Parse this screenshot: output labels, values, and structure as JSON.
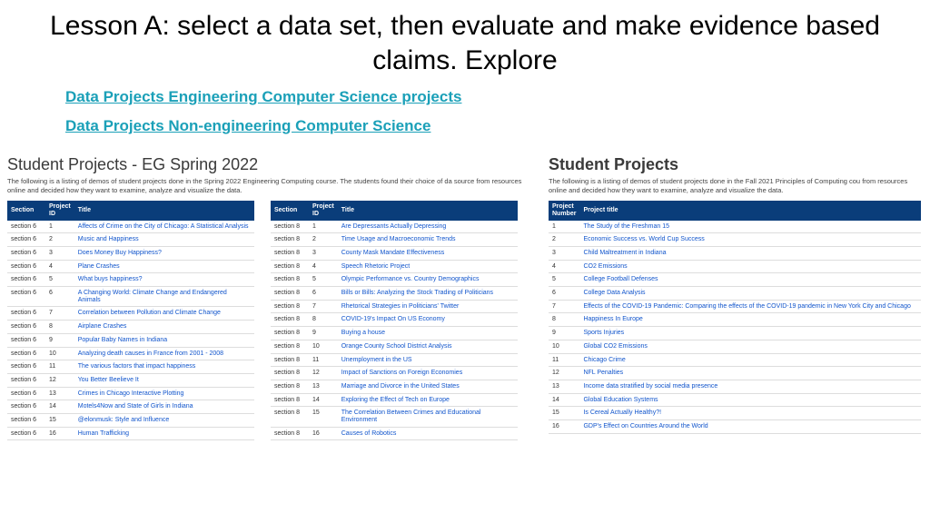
{
  "title": "Lesson A: select a data set, then evaluate and make evidence based claims. Explore",
  "links": {
    "eng": "Data Projects Engineering Computer Science projects",
    "noneng": "Data Projects Non-engineering Computer Science"
  },
  "left": {
    "heading": "Student Projects - EG Spring 2022",
    "desc": "The following is a listing of demos of student projects done in the Spring 2022 Engineering Computing course. The students found their choice of da source from resources online and decided how they want to examine, analyze and visualize the data.",
    "headers": {
      "section": "Section",
      "id": "Project ID",
      "title": "Title"
    },
    "section6": [
      {
        "id": "1",
        "title": "Affects of Crime on the City of Chicago: A Statistical Analysis"
      },
      {
        "id": "2",
        "title": "Music and Happiness"
      },
      {
        "id": "3",
        "title": "Does Money Buy Happiness?"
      },
      {
        "id": "4",
        "title": "Plane Crashes"
      },
      {
        "id": "5",
        "title": "What buys happiness?"
      },
      {
        "id": "6",
        "title": "A Changing World: Climate Change and Endangered Animals"
      },
      {
        "id": "7",
        "title": "Correlation between Pollution and Climate Change"
      },
      {
        "id": "8",
        "title": "Airplane Crashes"
      },
      {
        "id": "9",
        "title": "Popular Baby Names in Indiana"
      },
      {
        "id": "10",
        "title": "Analyzing death causes in France from 2001 - 2008"
      },
      {
        "id": "11",
        "title": "The various factors that impact happiness"
      },
      {
        "id": "12",
        "title": "You Better Beelieve It"
      },
      {
        "id": "13",
        "title": "Crimes in Chicago Interactive Plotting"
      },
      {
        "id": "14",
        "title": "Motels4Now and State of Girls in Indiana"
      },
      {
        "id": "15",
        "title": "@elonmusk: Style and Influence"
      },
      {
        "id": "16",
        "title": "Human Trafficking"
      }
    ],
    "sectionLabel6": "section 6",
    "section8": [
      {
        "id": "1",
        "title": "Are Depressants Actually Depressing"
      },
      {
        "id": "2",
        "title": "Time Usage and Macroeconomic Trends"
      },
      {
        "id": "3",
        "title": "County Mask Mandate Effectiveness"
      },
      {
        "id": "4",
        "title": "Speech Rhetoric Project"
      },
      {
        "id": "5",
        "title": "Olympic Performance vs. Country Demographics"
      },
      {
        "id": "6",
        "title": "Bills or Bills: Analyzing the Stock Trading of Politicians"
      },
      {
        "id": "7",
        "title": "Rhetorical Strategies in Politicians' Twitter"
      },
      {
        "id": "8",
        "title": "COVID-19's Impact On US Economy"
      },
      {
        "id": "9",
        "title": "Buying a house"
      },
      {
        "id": "10",
        "title": "Orange County School District Analysis"
      },
      {
        "id": "11",
        "title": "Unemployment in the US"
      },
      {
        "id": "12",
        "title": "Impact of Sanctions on Foreign Economies"
      },
      {
        "id": "13",
        "title": "Marriage and Divorce in the United States"
      },
      {
        "id": "14",
        "title": "Exploring the Effect of Tech on Europe"
      },
      {
        "id": "15",
        "title": "The Correlation Between Crimes and Educational Environment"
      },
      {
        "id": "16",
        "title": "Causes of Robotics"
      }
    ],
    "sectionLabel8": "section 8"
  },
  "right": {
    "heading": "Student Projects",
    "desc": "The following is a listing of demos of student projects done in the Fall 2021 Principles of Computing cou from resources online and decided how they want to examine, analyze and visualize the data.",
    "headers": {
      "num": "Project Number",
      "title": "Project title"
    },
    "rows": [
      {
        "n": "1",
        "title": "The Study of the Freshman 15"
      },
      {
        "n": "2",
        "title": "Economic Success vs. World Cup Success"
      },
      {
        "n": "3",
        "title": "Child Maltreatment in Indiana"
      },
      {
        "n": "4",
        "title": "CO2 Emissions"
      },
      {
        "n": "5",
        "title": "College Football Defenses"
      },
      {
        "n": "6",
        "title": "College Data Analysis"
      },
      {
        "n": "7",
        "title": "Effects of the COVID-19 Pandemic: Comparing the effects of the COVID-19 pandemic in New York City and Chicago"
      },
      {
        "n": "8",
        "title": "Happiness In Europe"
      },
      {
        "n": "9",
        "title": "Sports Injuries"
      },
      {
        "n": "10",
        "title": "Global CO2 Emissions"
      },
      {
        "n": "11",
        "title": "Chicago Crime"
      },
      {
        "n": "12",
        "title": "NFL Penalties"
      },
      {
        "n": "13",
        "title": "Income data stratified by social media presence"
      },
      {
        "n": "14",
        "title": "Global Education Systems"
      },
      {
        "n": "15",
        "title": "Is Cereal Actually Healthy?!"
      },
      {
        "n": "16",
        "title": "GDP's Effect on Countries Around the World"
      }
    ]
  }
}
